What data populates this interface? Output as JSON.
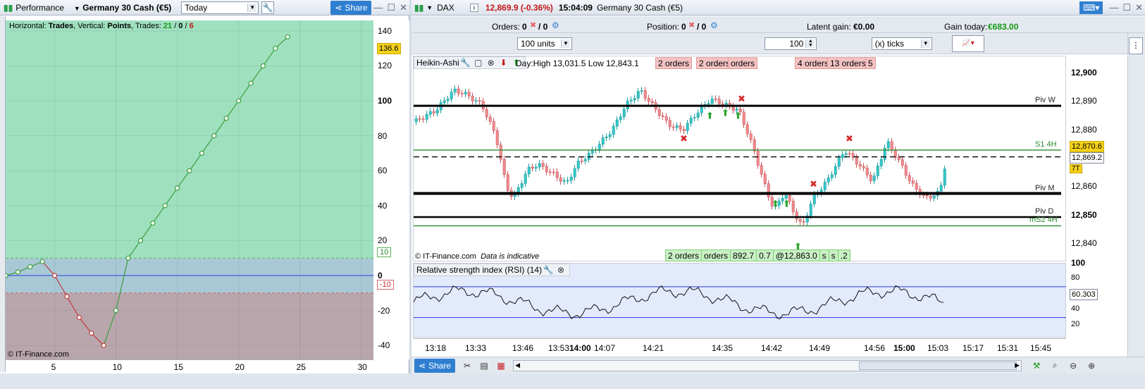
{
  "left_panel": {
    "title": "Performance",
    "instrument": "Germany 30 Cash (€5)",
    "period": "Today",
    "share": "Share",
    "caption_prefix": "Horizontal: ",
    "caption_h": "Trades",
    "caption_mid": ", Vertical: ",
    "caption_v": "Points",
    "caption_trades": ", Trades: ",
    "trades_total": "21",
    "trades_sep1": " / ",
    "trades_neutral": "0",
    "trades_sep2": " / ",
    "trades_loss": "6",
    "watermark": "© IT-Finance.com",
    "last_value_label": "136.6",
    "upper_band_label": "10",
    "lower_band_label": "-10",
    "y_ticks": [
      "140",
      "120",
      "100",
      "80",
      "60",
      "40",
      "20",
      "0",
      "-20",
      "-40"
    ],
    "x_ticks": [
      "5",
      "10",
      "15",
      "20",
      "25",
      "30"
    ]
  },
  "perf_chart_data": {
    "type": "line",
    "x": [
      1,
      2,
      3,
      4,
      5,
      6,
      7,
      8,
      9,
      10,
      11,
      12,
      13,
      14,
      15,
      16,
      17,
      18,
      19,
      20,
      21,
      22,
      23,
      24,
      25,
      26,
      27
    ],
    "y": [
      0,
      2,
      5,
      8,
      0,
      -12,
      -24,
      -33,
      -40,
      -20,
      10,
      20,
      30,
      40,
      50,
      60,
      70,
      80,
      90,
      100,
      110,
      120,
      130,
      136.6
    ],
    "xlim": [
      1,
      31
    ],
    "ylim": [
      -48,
      146
    ],
    "band": [
      -10,
      10
    ]
  },
  "right_panel": {
    "symbol": "DAX",
    "price": "12,869.9 (-0.36%)",
    "time": "15:04:09",
    "instrument": "Germany 30 Cash (€5)",
    "orders_label": "Orders:",
    "orders_value": "0",
    "orders_value2": "/ 0",
    "position_label": "Position:",
    "position_value": "0",
    "position_value2": "/ 0",
    "latent_label": "Latent gain:",
    "latent_value": "€0.00",
    "gain_label": "Gain today:",
    "gain_value": "€683.00",
    "units_select": "100 units",
    "qty_value": "100",
    "ticks_select": "(x) ticks",
    "chart_type": "Heikin-Ashi",
    "day_info": "Day:High 13,031.5 Low 12,843.1",
    "order_tags": [
      "2 orders",
      "2 orders",
      "orders",
      "4 orders",
      "13 orders",
      "5"
    ],
    "bottom_tags": [
      "2 orders",
      "orders",
      "892.7",
      "0.7",
      "@12,863.0",
      "s",
      "s",
      ".2"
    ],
    "watermark": "© IT-Finance.com",
    "indicative": "Data is indicative",
    "line_labels": {
      "piv_w": "Piv W",
      "s1": "S1 4H",
      "piv_m": "Piv M",
      "piv_d": "Piv D",
      "ms2": "mS2 4H"
    },
    "price_ticks": [
      "12,900",
      "12,890",
      "12,880",
      "12,860",
      "12,850",
      "12,840"
    ],
    "price_tag_1": "12,870.6",
    "price_tag_2": "12,869.2",
    "tag_7t": "7T",
    "rsi_title": "Relative strength index (RSI) (14)",
    "rsi_value": "60.303",
    "rsi_ticks": [
      "100",
      "80",
      "40",
      "20"
    ],
    "time_ticks": [
      "13:18",
      "13:33",
      "13:46",
      "13:53",
      "14:00",
      "14:07",
      "14:21",
      "14:35",
      "14:42",
      "14:49",
      "14:56",
      "15:00",
      "15:03",
      "15:17",
      "15:31",
      "15:45"
    ],
    "share": "Share"
  },
  "colors": {
    "profit_zone": "#9fe0bf",
    "loss_zone": "#b9a6ad",
    "bull_candle": "#33c7c9",
    "bear_candle": "#f08a8e",
    "accent": "#2f7fd0"
  }
}
